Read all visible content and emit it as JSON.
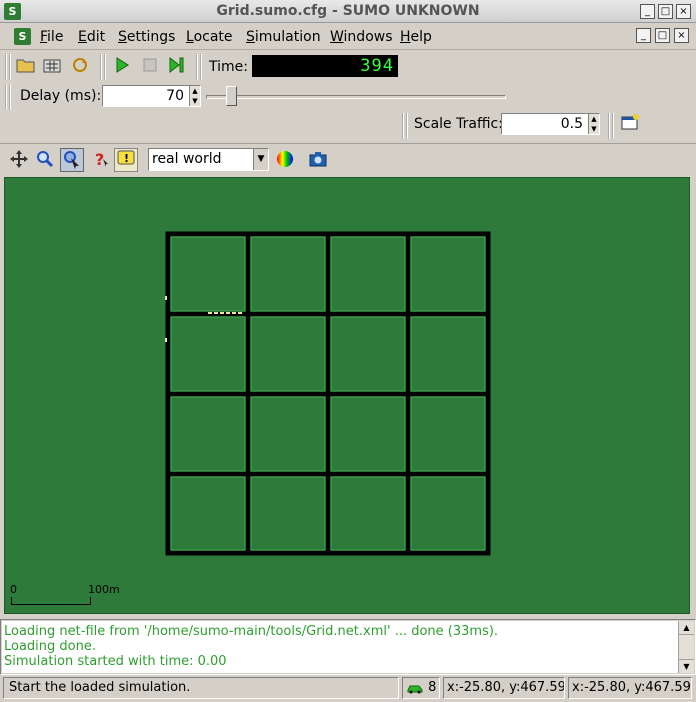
{
  "window": {
    "title": "Grid.sumo.cfg - SUMO UNKNOWN",
    "app_icon": "sumo-app-icon"
  },
  "window_controls": {
    "minimize": "_",
    "maximize": "□",
    "close": "×"
  },
  "menubar": {
    "items": [
      {
        "label": "File",
        "u": "F",
        "rest": "ile"
      },
      {
        "label": "Edit",
        "u": "E",
        "rest": "dit"
      },
      {
        "label": "Settings",
        "u": "S",
        "rest": "ettings"
      },
      {
        "label": "Locate",
        "u": "L",
        "rest": "ocate"
      },
      {
        "label": "Simulation",
        "u": "S",
        "rest": "imulation"
      },
      {
        "label": "Windows",
        "u": "W",
        "rest": "indows"
      },
      {
        "label": "Help",
        "u": "H",
        "rest": "elp"
      }
    ]
  },
  "toolbar": {
    "time_label": "Time:",
    "time_value": "394",
    "delay_label": "Delay (ms):",
    "delay_value": "70",
    "delay_slider_fraction": 0.07,
    "scale_label": "Scale Traffic:",
    "scale_value": "0.5"
  },
  "view_toolbar": {
    "scheme": "real world"
  },
  "scale_bar": {
    "start": "0",
    "end": "100m"
  },
  "log": {
    "lines": [
      "Loading net-file from '/home/sumo-main/tools/Grid.net.xml' ... done (33ms).",
      "Loading done.",
      "Simulation started with time: 0.00"
    ]
  },
  "statusbar": {
    "message": "Start the loaded simulation.",
    "vehicle_count": "8",
    "coord1": "x:-25.80, y:467.59",
    "coord2": "x:-25.80, y:467.59"
  },
  "colors": {
    "canvas": "#2d7a3a",
    "road": "#000000",
    "log_text": "#2f9e2f",
    "time_text": "#3cff3c"
  }
}
